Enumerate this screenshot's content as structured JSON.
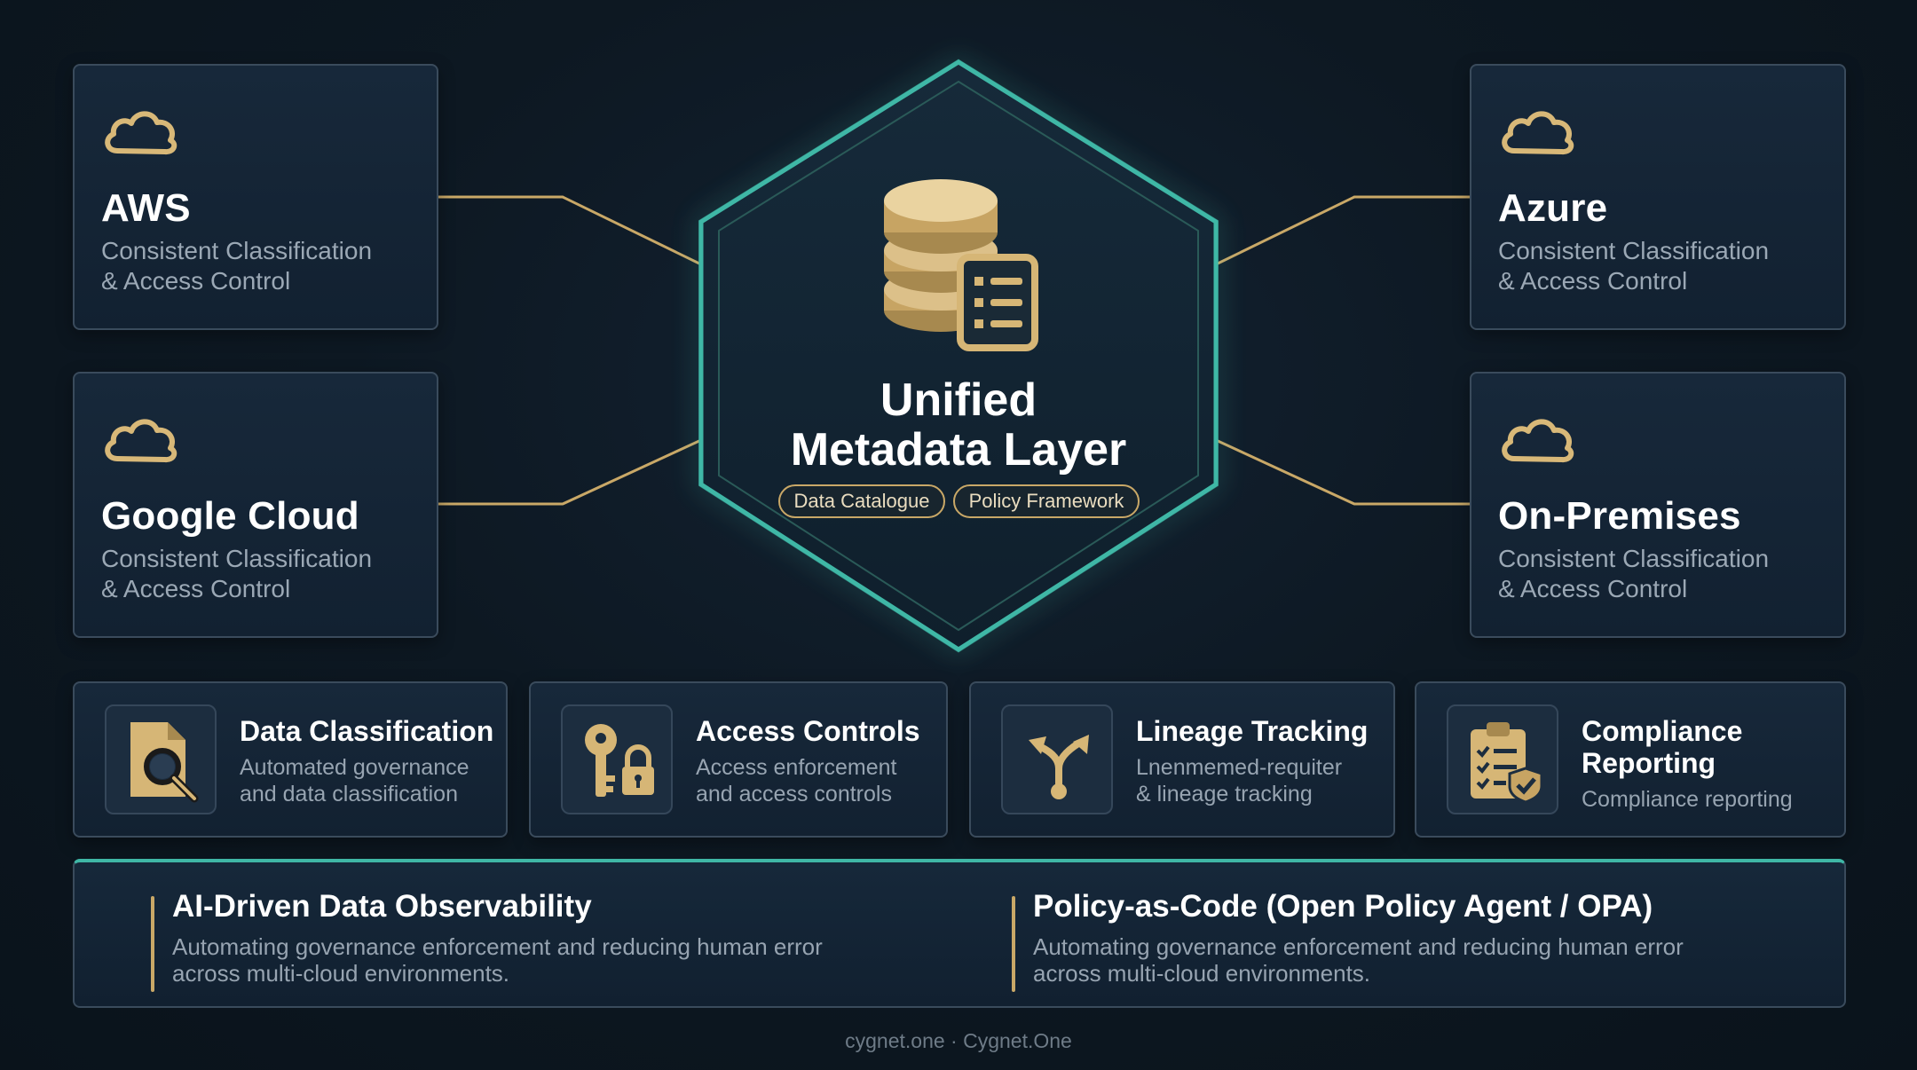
{
  "hub": {
    "title_line1": "Unified",
    "title_line2": "Metadata Layer",
    "tags": [
      "Data Catalogue",
      "Policy Framework"
    ]
  },
  "clouds": [
    {
      "name": "AWS",
      "desc_line1": "Consistent Classification",
      "desc_line2": "& Access Control"
    },
    {
      "name": "Google Cloud",
      "desc_line1": "Consistent Classification",
      "desc_line2": "& Access Control"
    },
    {
      "name": "Azure",
      "desc_line1": "Consistent Classification",
      "desc_line2": "& Access Control"
    },
    {
      "name": "On-Premises",
      "desc_line1": "Consistent Classification",
      "desc_line2": "& Access Control"
    }
  ],
  "features": [
    {
      "title_line1": "Data Classification",
      "title_line2": "",
      "desc_line1": "Automated governance",
      "desc_line2": "and data classification",
      "icon": "document-search-icon"
    },
    {
      "title_line1": "Access Controls",
      "title_line2": "",
      "desc_line1": "Access enforcement",
      "desc_line2": "and access controls",
      "icon": "key-lock-icon"
    },
    {
      "title_line1": "Lineage Tracking",
      "title_line2": "",
      "desc_line1": "Lnenmemed-requiter",
      "desc_line2": "& lineage tracking",
      "icon": "branch-arrows-icon"
    },
    {
      "title_line1": "Compliance",
      "title_line2": "Reporting",
      "desc_line1": "Compliance reporting",
      "desc_line2": "",
      "icon": "clipboard-check-icon"
    }
  ],
  "bottom": [
    {
      "title": "AI-Driven Data Observability",
      "desc_line1": "Automating governance enforcement and reducing human error",
      "desc_line2": "across multi-cloud environments."
    },
    {
      "title": "Policy-as-Code (Open Policy Agent / OPA)",
      "desc_line1": "Automating governance enforcement and reducing human error",
      "desc_line2": "across multi-cloud environments."
    }
  ],
  "footer": "cygnet.one · Cygnet.One",
  "colors": {
    "accent_gold": "#c9a867",
    "accent_teal": "#3fb7a6",
    "background": "#0d1822",
    "card": "#15263a"
  }
}
